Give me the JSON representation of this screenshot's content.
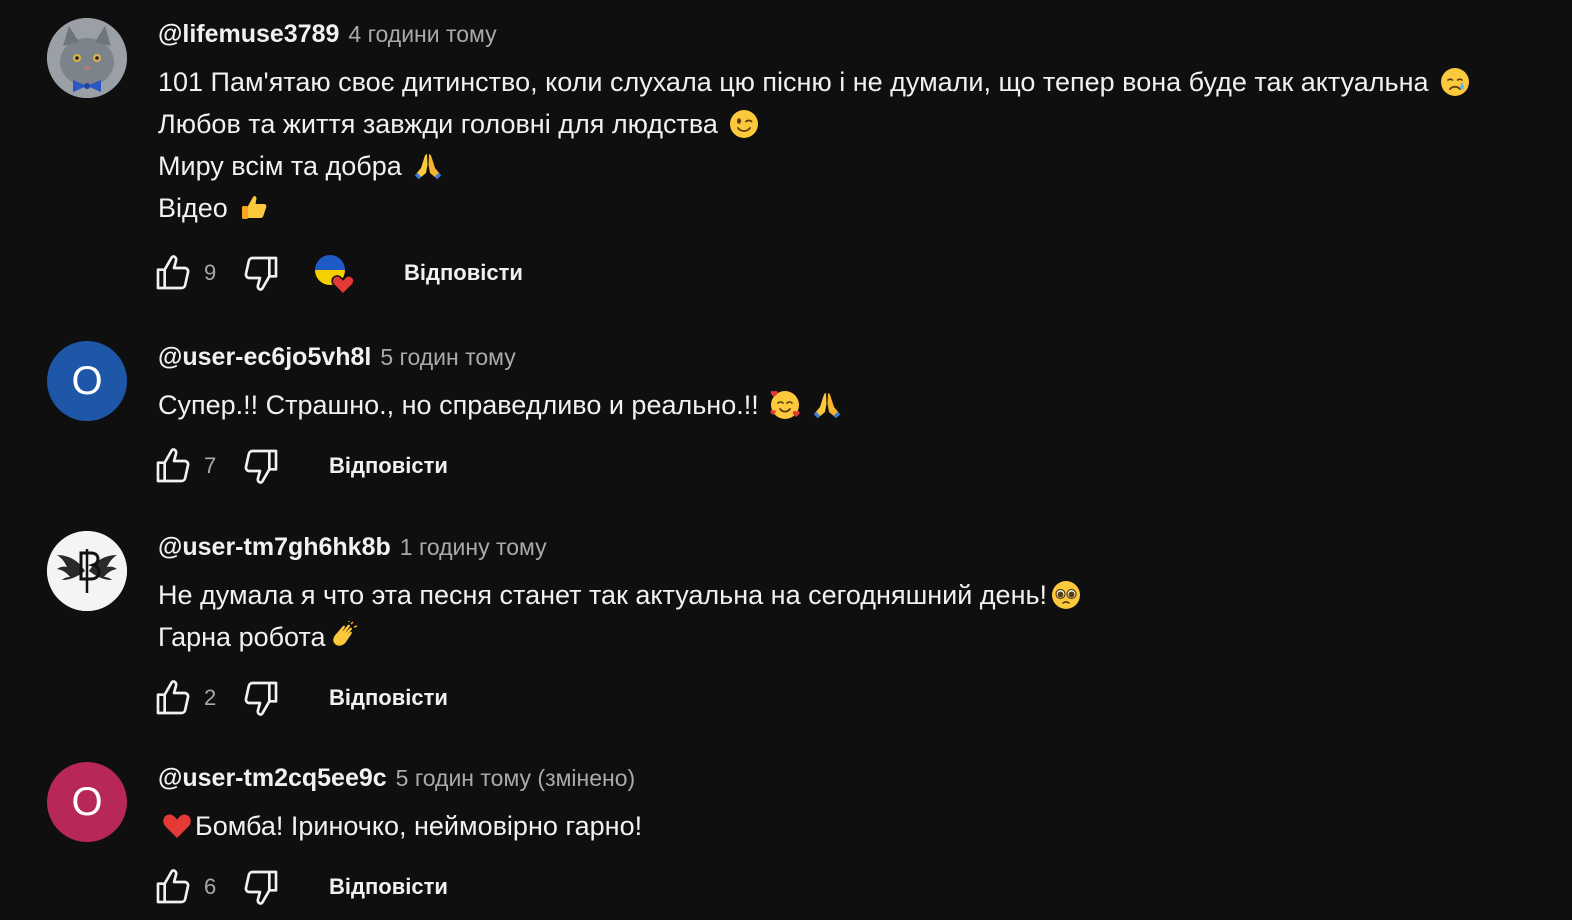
{
  "comments": [
    {
      "author": "@lifemuse3789",
      "time": "4 години тому",
      "avatar": {
        "type": "image",
        "icon": "cat-with-bowtie-avatar"
      },
      "lines": [
        "101 Пам'ятаю своє дитинство, коли слухала цю пісню і не думали, що тепер вона буде так актуальна",
        "Любов та життя завжди головні для людства",
        "Миру всім та добра",
        "Відео"
      ],
      "emojis": [
        "crying-face-emoji",
        "winking-face-emoji",
        "folded-hands-emoji",
        "thumbs-up-emoji"
      ],
      "likes": "9",
      "creator_heart": true,
      "reply_label": "Відповісти"
    },
    {
      "author": "@user-ec6jo5vh8l",
      "time": "5 годин тому",
      "avatar": {
        "type": "letter",
        "letter": "O",
        "color": "#1f57a8"
      },
      "lines": [
        "Супер.!! Страшно., но справедливо и реально.!!"
      ],
      "emojis": [
        "smiling-face-with-hearts-emoji",
        "folded-hands-emoji"
      ],
      "likes": "7",
      "creator_heart": false,
      "reply_label": "Відповісти"
    },
    {
      "author": "@user-tm7gh6hk8b",
      "time": "1 годину тому",
      "avatar": {
        "type": "image",
        "icon": "winged-monogram-avatar"
      },
      "lines": [
        "Не думала я что эта песня станет так актуальна на сегодняшний день!",
        "Гарна робота"
      ],
      "emojis": [
        "pleading-face-emoji",
        "clapping-hands-emoji"
      ],
      "likes": "2",
      "creator_heart": false,
      "reply_label": "Відповісти"
    },
    {
      "author": "@user-tm2cq5ee9c",
      "time": "5 годин тому (змінено)",
      "avatar": {
        "type": "letter",
        "letter": "O",
        "color": "#b8275a"
      },
      "lines": [
        "Бомба! Іриночко, неймовірно гарно!"
      ],
      "emojis": [
        "red-heart-emoji"
      ],
      "likes": "6",
      "creator_heart": false,
      "reply_label": "Відповісти"
    }
  ],
  "colors": {
    "background": "#0f0f0f",
    "text": "#f1f1f1",
    "secondary_text": "#aaaaaa",
    "heart": "#e53935"
  }
}
